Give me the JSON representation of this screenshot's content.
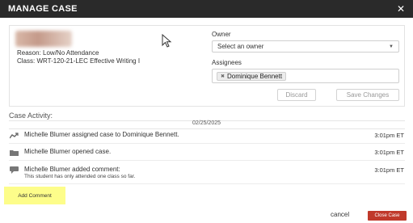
{
  "header": {
    "title": "MANAGE CASE",
    "close_icon": "close-icon"
  },
  "case": {
    "reason": "Reason: Low/No Attendance",
    "class": "Class: WRT-120-21-LEC Effective Writing I"
  },
  "owner": {
    "label": "Owner",
    "placeholder": "Select an owner"
  },
  "assignees": {
    "label": "Assignees",
    "chips": [
      "Dominique Bennett"
    ]
  },
  "buttons": {
    "discard": "Discard",
    "save_changes": "Save Changes"
  },
  "activity": {
    "title": "Case Activity:",
    "date": "02/25/2025",
    "items": [
      {
        "icon": "trend-icon",
        "text": "Michelle Blumer assigned case to Dominique Bennett.",
        "time": "3:01pm ET"
      },
      {
        "icon": "folder-icon",
        "text": "Michelle Blumer opened case.",
        "time": "3:01pm ET"
      },
      {
        "icon": "comment-icon",
        "text": "Michelle Blumer added comment:",
        "sub": "This student has only attended one class so far.",
        "time": "3:01pm ET"
      }
    ]
  },
  "footer": {
    "add_comment": "Add Comment",
    "cancel": "cancel",
    "close_case": "Close Case"
  },
  "colors": {
    "header_bg": "#2a2a2a",
    "highlight": "#fdfd8a",
    "close_case_bg": "#c0392b"
  }
}
